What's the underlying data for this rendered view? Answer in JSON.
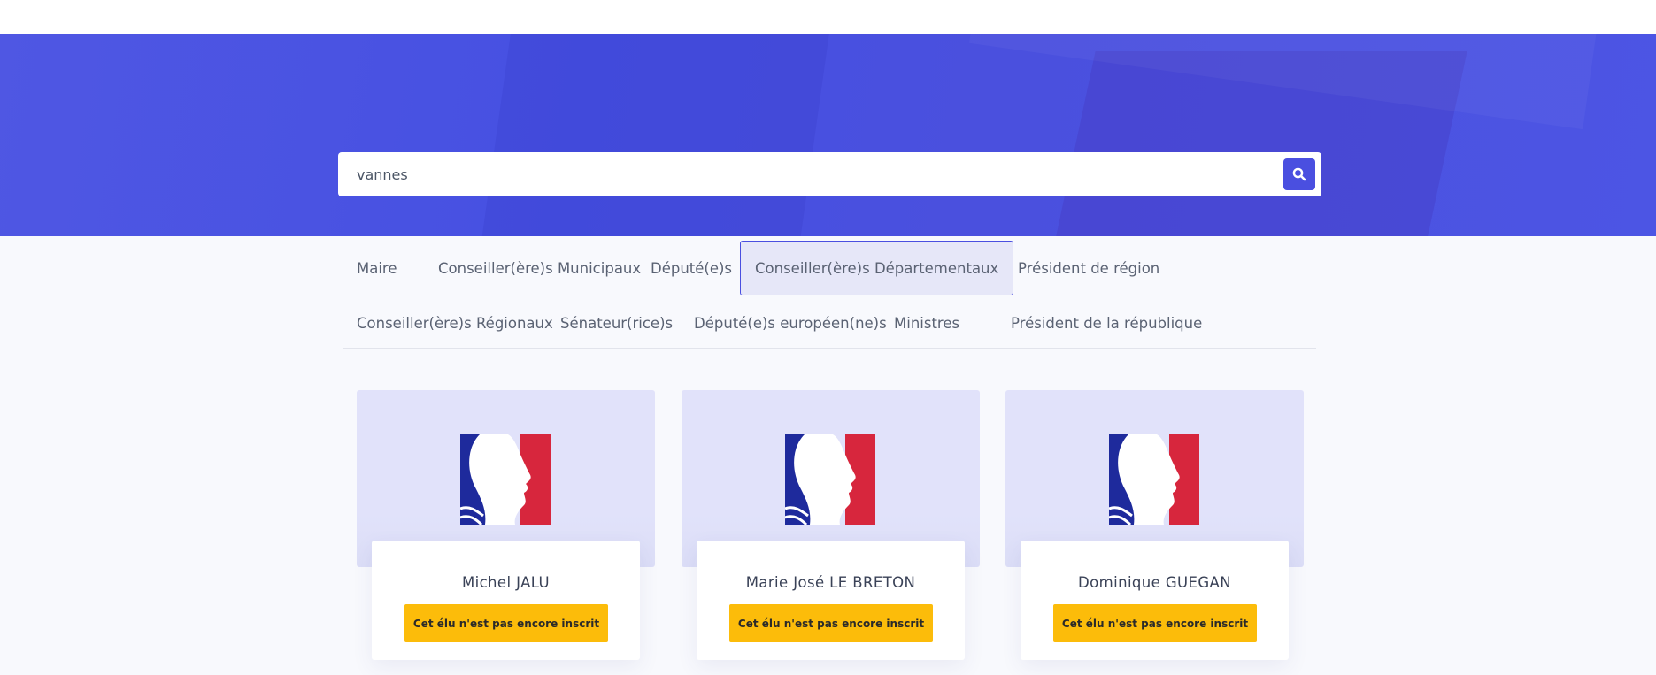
{
  "search": {
    "value": "vannes"
  },
  "tabs": [
    {
      "label": "Maire"
    },
    {
      "label": "Conseiller(ère)s Municipaux"
    },
    {
      "label": "Député(e)s"
    },
    {
      "label": "Conseiller(ère)s Départementaux",
      "active": true
    },
    {
      "label": "Président de région"
    },
    {
      "label": "Conseiller(ère)s Régionaux"
    },
    {
      "label": "Sénateur(rice)s"
    },
    {
      "label": "Député(e)s européen(ne)s"
    },
    {
      "label": "Ministres"
    },
    {
      "label": "Président de la république"
    }
  ],
  "cards": [
    {
      "name": "Michel JALU",
      "cta": "Cet élu n'est pas encore inscrit"
    },
    {
      "name": "Marie José LE BRETON",
      "cta": "Cet élu n'est pas encore inscrit"
    },
    {
      "name": "Dominique GUEGAN",
      "cta": "Cet élu n'est pas encore inscrit"
    }
  ],
  "colors": {
    "accent": "#4a4fe0",
    "cta": "#fcbc0a",
    "flag_blue": "#1e2a9c",
    "flag_red": "#d7263d"
  },
  "icons": {
    "search": "search-icon",
    "logo": "marianne-logo-icon"
  }
}
